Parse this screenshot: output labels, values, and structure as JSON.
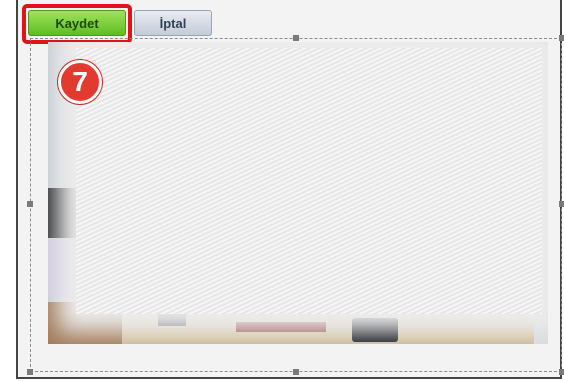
{
  "toolbar": {
    "save_label": "Kaydet",
    "cancel_label": "İptal"
  },
  "annotation": {
    "step_number": "7"
  },
  "colors": {
    "save_button": "#6cc72a",
    "highlight_box": "#e0131b",
    "step_badge": "#e33a2f"
  }
}
